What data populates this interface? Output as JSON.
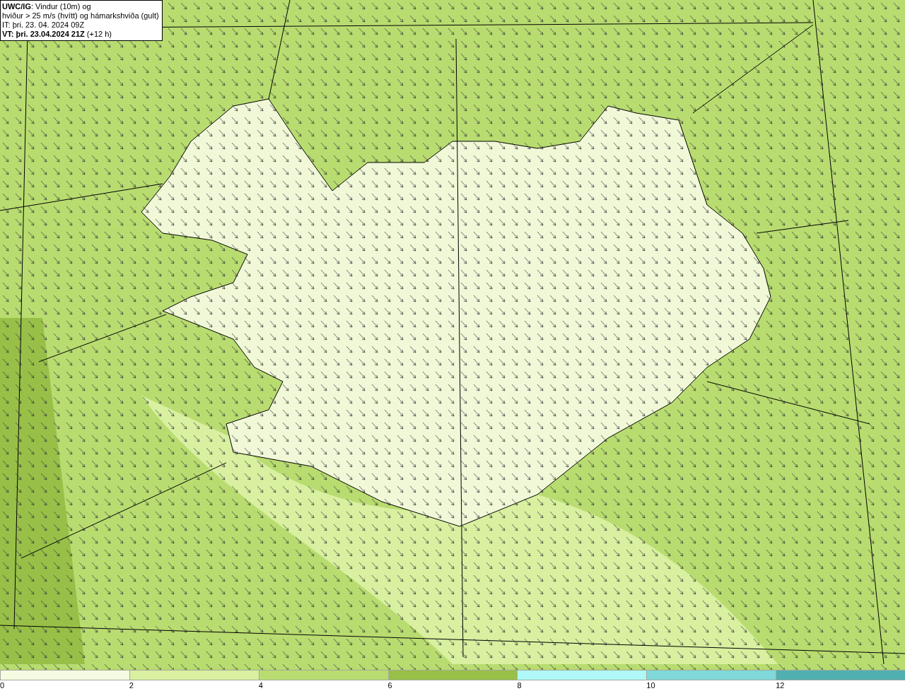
{
  "title_box": {
    "lines": [
      "**UWC/IG**: Vindur (10m) og",
      "hviður > 25 m/s (hvítt) og hámarkshviða (gult)",
      "IT: þri. 23. 04. 2024 09Z",
      "**VT: þri. 23.04.2024 21Z** (+12 h)"
    ]
  },
  "legend": [
    {
      "label": "0",
      "color": "#f4fbe0"
    },
    {
      "label": "2",
      "color": "#d8f0a0"
    },
    {
      "label": "4",
      "color": "#b8dc70"
    },
    {
      "label": "6",
      "color": "#98c048"
    },
    {
      "label": "8",
      "color": "#b0f8f8"
    },
    {
      "label": "10",
      "color": "#80d8d8"
    },
    {
      "label": "12",
      "color": "#50b0b0"
    }
  ]
}
